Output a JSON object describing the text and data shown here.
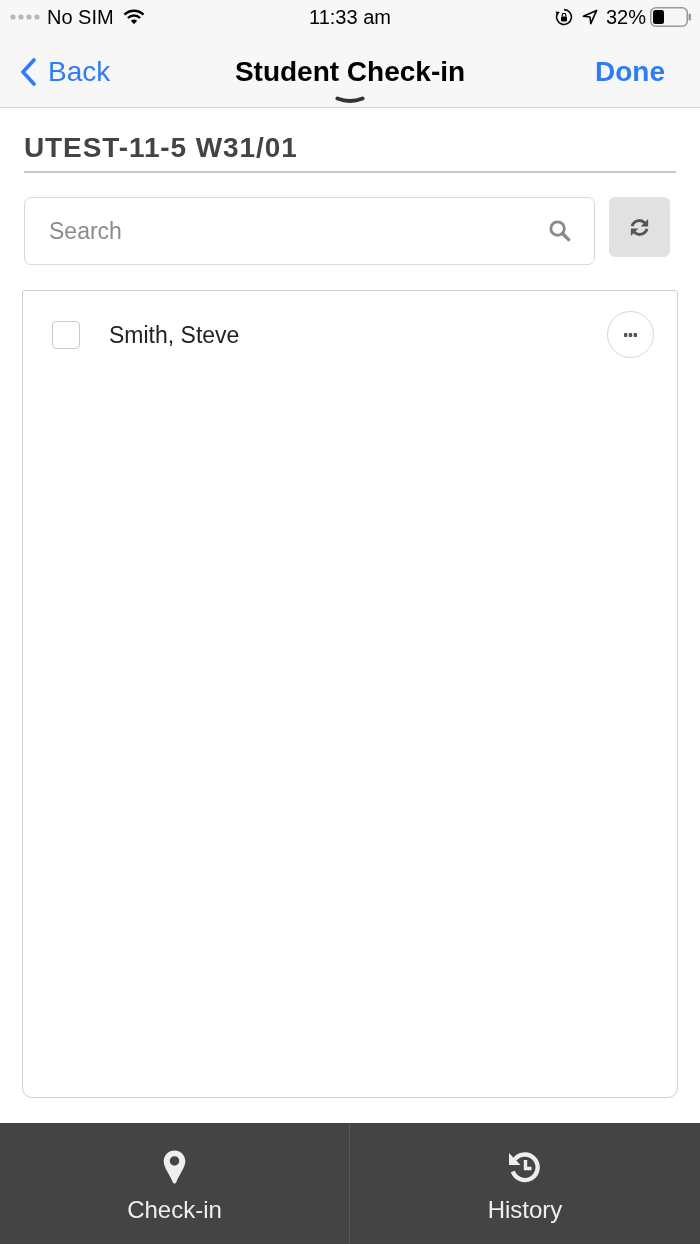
{
  "status_bar": {
    "carrier": "No SIM",
    "time": "11:33 am",
    "battery": "32%"
  },
  "nav_bar": {
    "back": "Back",
    "title": "Student Check-in",
    "done": "Done"
  },
  "heading": "UTEST-11-5 W31/01",
  "search": {
    "placeholder": "Search"
  },
  "students": [
    {
      "name": "Smith, Steve",
      "checked": false
    }
  ],
  "tab_bar": [
    {
      "label": "Check-in"
    },
    {
      "label": "History"
    }
  ]
}
